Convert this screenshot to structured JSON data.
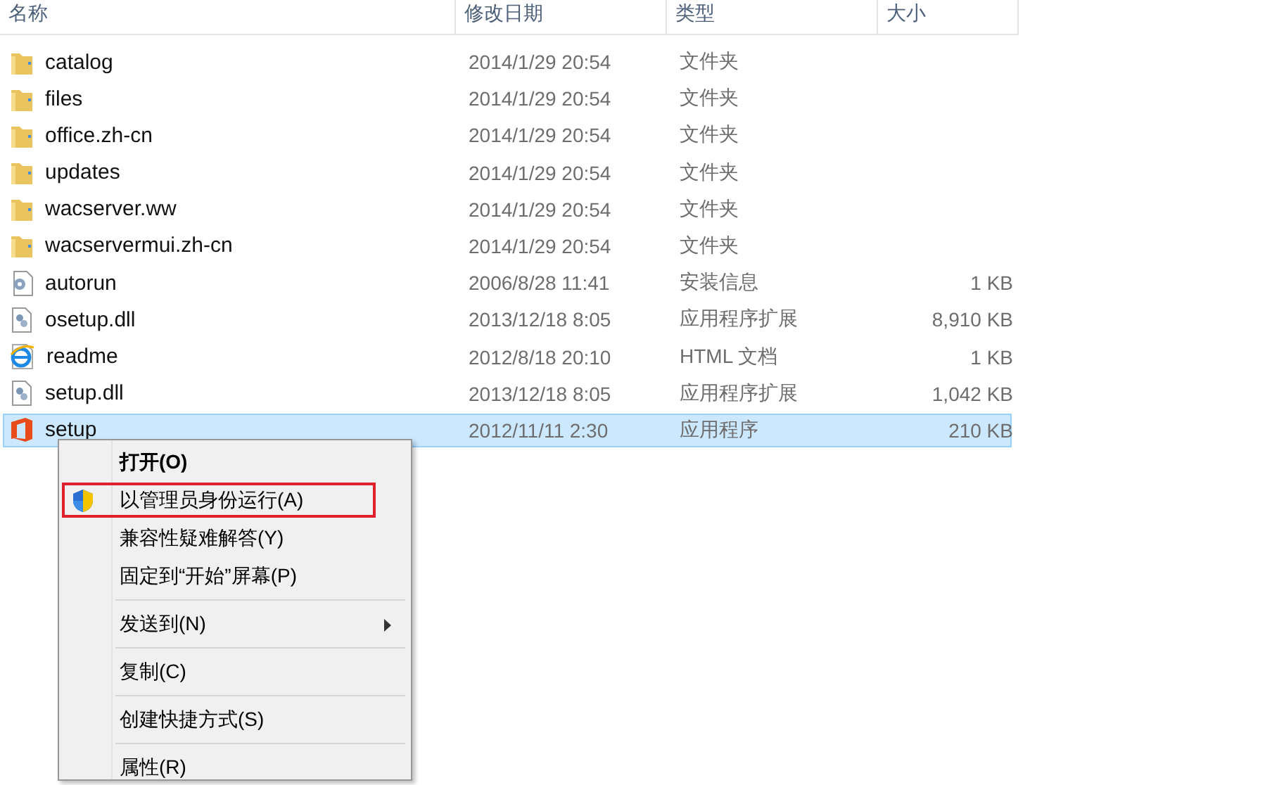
{
  "columns": [
    "名称",
    "修改日期",
    "类型",
    "大小"
  ],
  "files": [
    {
      "name": "catalog",
      "date": "2014/1/29 20:54",
      "type": "文件夹",
      "kind": "folder",
      "selected": false
    },
    {
      "name": "files",
      "date": "2014/1/29 20:54",
      "type": "文件夹",
      "kind": "folder",
      "selected": false
    },
    {
      "name": "office.zh-cn",
      "date": "2014/1/29 20:54",
      "type": "文件夹",
      "kind": "folder",
      "selected": false
    },
    {
      "name": "updates",
      "date": "2014/1/29 20:54",
      "type": "文件夹",
      "kind": "folder",
      "selected": false
    },
    {
      "name": "wacserver.ww",
      "date": "2014/1/29 20:54",
      "type": "文件夹",
      "kind": "folder",
      "selected": false
    },
    {
      "name": "wacservermui.zh-cn",
      "date": "2014/1/29 20:54",
      "type": "文件夹",
      "kind": "folder",
      "selected": false
    },
    {
      "name": "autorun",
      "date": "2006/8/28 11:41",
      "type": "安装信息",
      "size": "1 KB",
      "kind": "settings",
      "selected": false
    },
    {
      "name": "osetup.dll",
      "date": "2013/12/18 8:05",
      "type": "应用程序扩展",
      "size": "8,910 KB",
      "kind": "dll",
      "selected": false
    },
    {
      "name": "readme",
      "date": "2012/8/18 20:10",
      "type": "HTML 文档",
      "size": "1 KB",
      "kind": "html",
      "selected": false
    },
    {
      "name": "setup.dll",
      "date": "2013/12/18 8:05",
      "type": "应用程序扩展",
      "size": "1,042 KB",
      "kind": "dll",
      "selected": false
    },
    {
      "name": "setup",
      "date": "2012/11/11 2:30",
      "type": "应用程序",
      "size": "210 KB",
      "kind": "app",
      "selected": true
    }
  ],
  "context_menu": {
    "groups": [
      [
        {
          "label": "打开(O)",
          "bold": true,
          "highlighted": false
        },
        {
          "label": "以管理员身份运行(A)",
          "kind": "admin",
          "highlighted": true
        },
        {
          "label": "兼容性疑难解答(Y)",
          "highlighted": false
        },
        {
          "label": "固定到“开始”屏幕(P)",
          "highlighted": false
        }
      ],
      [
        {
          "label": "发送到(N)",
          "submenu": true,
          "highlighted": false
        }
      ],
      [
        {
          "label": "复制(C)",
          "highlighted": false
        }
      ],
      [
        {
          "label": "创建快捷方式(S)",
          "highlighted": false
        }
      ],
      [
        {
          "label": "属性(R)",
          "highlighted": false
        }
      ]
    ]
  }
}
